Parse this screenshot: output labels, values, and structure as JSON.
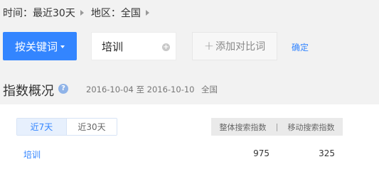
{
  "breadcrumb": {
    "time": "时间：最近30天",
    "region": "地区：全国"
  },
  "controls": {
    "keyword_button": "按关键词",
    "keyword_value": "培训",
    "add_compare": "添加对比词",
    "add_compare_icon": "+",
    "confirm": "确定"
  },
  "overview": {
    "title": "指数概况",
    "help_icon": "?",
    "date_range": "2016-10-04 至 2016-10-10",
    "region": "全国"
  },
  "panel": {
    "tabs": [
      "近7天",
      "近30天"
    ],
    "active_tab": "近7天",
    "columns": [
      "整体搜索指数",
      "移动搜索指数"
    ],
    "separator": "|",
    "row": {
      "keyword": "培训",
      "overall": "975",
      "mobile": "325"
    }
  },
  "colors": {
    "accent": "#3385ff",
    "background": "#f2f2f2"
  }
}
